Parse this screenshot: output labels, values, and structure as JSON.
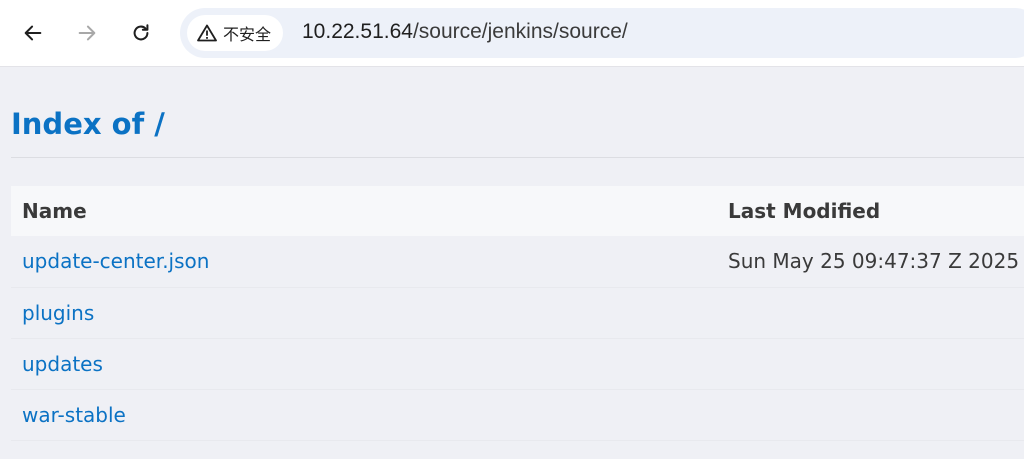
{
  "browser": {
    "security_label": "不安全",
    "url_host": "10.22.51.64",
    "url_path": "/source/jenkins/source/"
  },
  "page": {
    "title": "Index of /",
    "columns": {
      "name": "Name",
      "last_modified": "Last Modified"
    },
    "rows": [
      {
        "name": "update-center.json",
        "modified": "Sun May 25 09:47:37 Z 2025"
      },
      {
        "name": "plugins",
        "modified": ""
      },
      {
        "name": "updates",
        "modified": ""
      },
      {
        "name": "war-stable",
        "modified": ""
      }
    ]
  },
  "colors": {
    "link": "#0b72c4",
    "page_background": "#eff0f5"
  }
}
